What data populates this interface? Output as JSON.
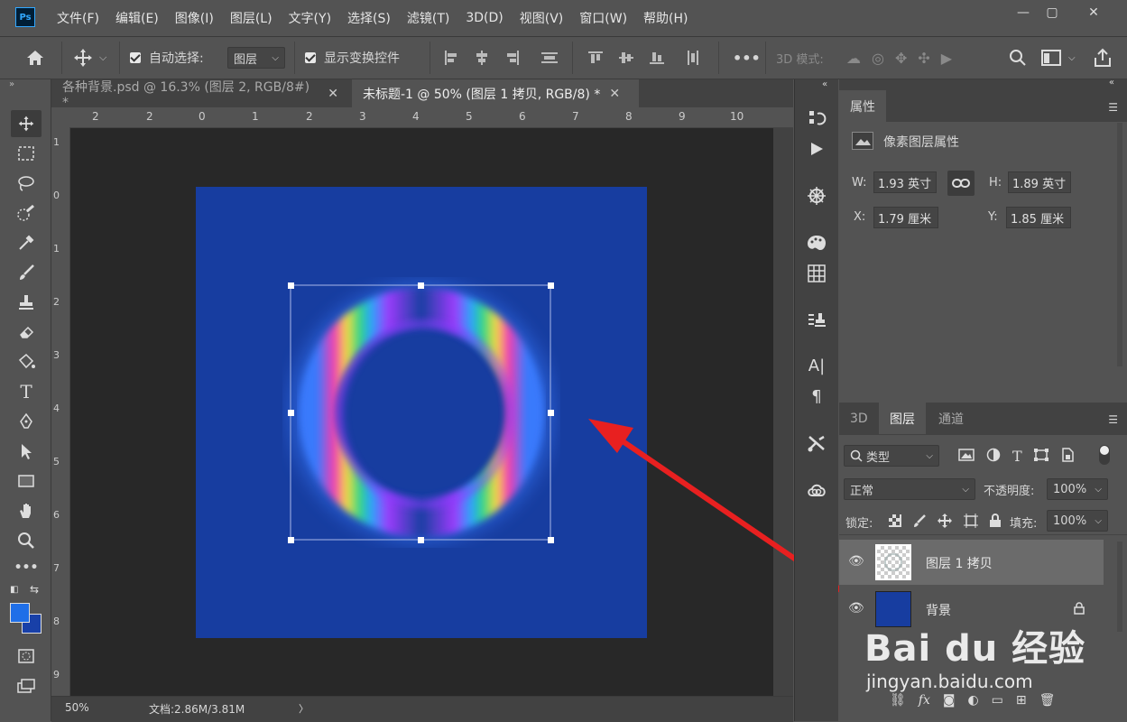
{
  "app": {
    "logo": "Ps",
    "menu": [
      "文件(F)",
      "编辑(E)",
      "图像(I)",
      "图层(L)",
      "文字(Y)",
      "选择(S)",
      "滤镜(T)",
      "3D(D)",
      "视图(V)",
      "窗口(W)",
      "帮助(H)"
    ]
  },
  "window": {
    "minimize": "—",
    "maximize": "▢",
    "close": "✕"
  },
  "options": {
    "auto_select_label": "自动选择:",
    "auto_select_target": "图层",
    "show_transform_label": "显示变换控件",
    "more": "•••",
    "mode_3d": "3D 模式:"
  },
  "tabs": [
    {
      "label": "各种背景.psd @ 16.3% (图层 2, RGB/8#) *",
      "close": "✕"
    },
    {
      "label": "未标题-1 @ 50% (图层 1 拷贝, RGB/8) *",
      "close": "✕"
    }
  ],
  "ruler": {
    "top": [
      "2",
      "2",
      "0",
      "1",
      "2",
      "3",
      "4",
      "5",
      "6",
      "7",
      "8",
      "9",
      "10"
    ],
    "left": [
      "1",
      "0",
      "1",
      "2",
      "3",
      "4",
      "5",
      "6",
      "7",
      "8",
      "9"
    ]
  },
  "status": {
    "zoom": "50%",
    "doc": "文档:2.86M/3.81M",
    "arrow": "〉"
  },
  "properties": {
    "tab": "属性",
    "type": "像素图层属性",
    "w_label": "W:",
    "w": "1.93 英寸",
    "h_label": "H:",
    "h": "1.89 英寸",
    "x_label": "X:",
    "x": "1.79 厘米",
    "y_label": "Y:",
    "y": "1.85 厘米"
  },
  "layers_panel": {
    "tabs": [
      "3D",
      "图层",
      "通道"
    ],
    "filter": "类型",
    "blend": "正常",
    "opacity_label": "不透明度:",
    "opacity": "100%",
    "lock_label": "锁定:",
    "fill_label": "填充:",
    "fill": "100%",
    "layers": [
      {
        "name": "图层 1 拷贝",
        "selected": true
      },
      {
        "name": "背景",
        "selected": false
      }
    ]
  },
  "colors": {
    "canvas_bg": "#173da0",
    "foreground": "#1f6fe8",
    "background": "#1840a8",
    "arrow": "#e82020"
  },
  "watermark": {
    "brand": "Bai du 经验",
    "url": "jingyan.baidu.com"
  }
}
